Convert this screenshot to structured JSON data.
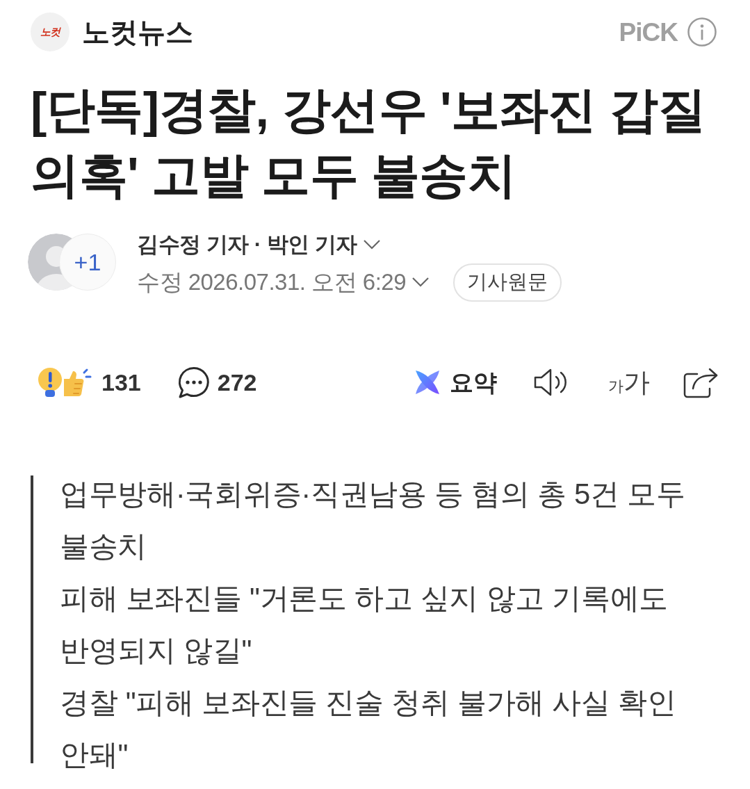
{
  "header": {
    "logo_text": "노컷",
    "press_name": "노컷뉴스",
    "pick_label": "PiCK"
  },
  "headline": "[단독]경찰, 강선우 '보좌진 갑질 의혹' 고발 모두 불송치",
  "byline": {
    "extra_authors": "+1",
    "authors": "김수정 기자 · 박인 기자",
    "timestamp": "수정 2026.07.31. 오전 6:29",
    "original_button": "기사원문"
  },
  "actions": {
    "reactions_count": "131",
    "comments_count": "272",
    "summary_label": "요약",
    "font_small": "가",
    "font_large": "가"
  },
  "summary": [
    "업무방해·국회위증·직권남용 등 혐의 총 5건 모두 불송치",
    "피해 보좌진들 \"거론도 하고 싶지 않고 기록에도 반영되지 않길\"",
    "경찰 \"피해 보좌진들 진술 청취 불가해 사실 확인 안돼\""
  ]
}
